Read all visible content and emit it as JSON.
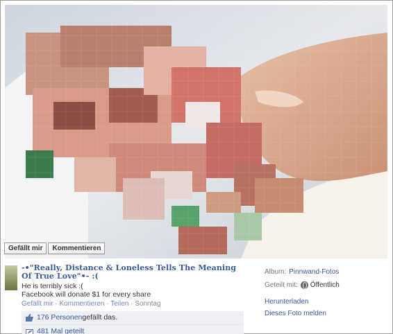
{
  "photo_actions": {
    "like_label": "Gefällt mir",
    "comment_label": "Kommentieren"
  },
  "post": {
    "title": "-•\"Really, Distance & Loneless Tells The Meaning Of True Love\"•- :(",
    "line1": "He is terribly sick :(",
    "line2": "Facebook will donate $1 for every share",
    "meta": {
      "like": "Gefällt mir",
      "comment": "Kommentieren",
      "share": "Teilen",
      "time": "Sonntag",
      "sep": " · "
    }
  },
  "likes": {
    "people_link": "176 Personen",
    "people_suffix": " gefällt das.",
    "shares_link": "481 Mal geteilt"
  },
  "sidebar": {
    "album_label": "Album:",
    "album_value": "Pinnwand-Fotos",
    "shared_label": "Geteilt mit:",
    "shared_value": "Öffentlich",
    "download": "Herunterladen",
    "report": "Dieses Foto melden"
  },
  "colors": {
    "link": "#3b5998",
    "likes_bg": "#edeff4"
  },
  "icons": {
    "like": "thumbs-up-icon",
    "share": "share-icon",
    "privacy": "globe-icon"
  }
}
